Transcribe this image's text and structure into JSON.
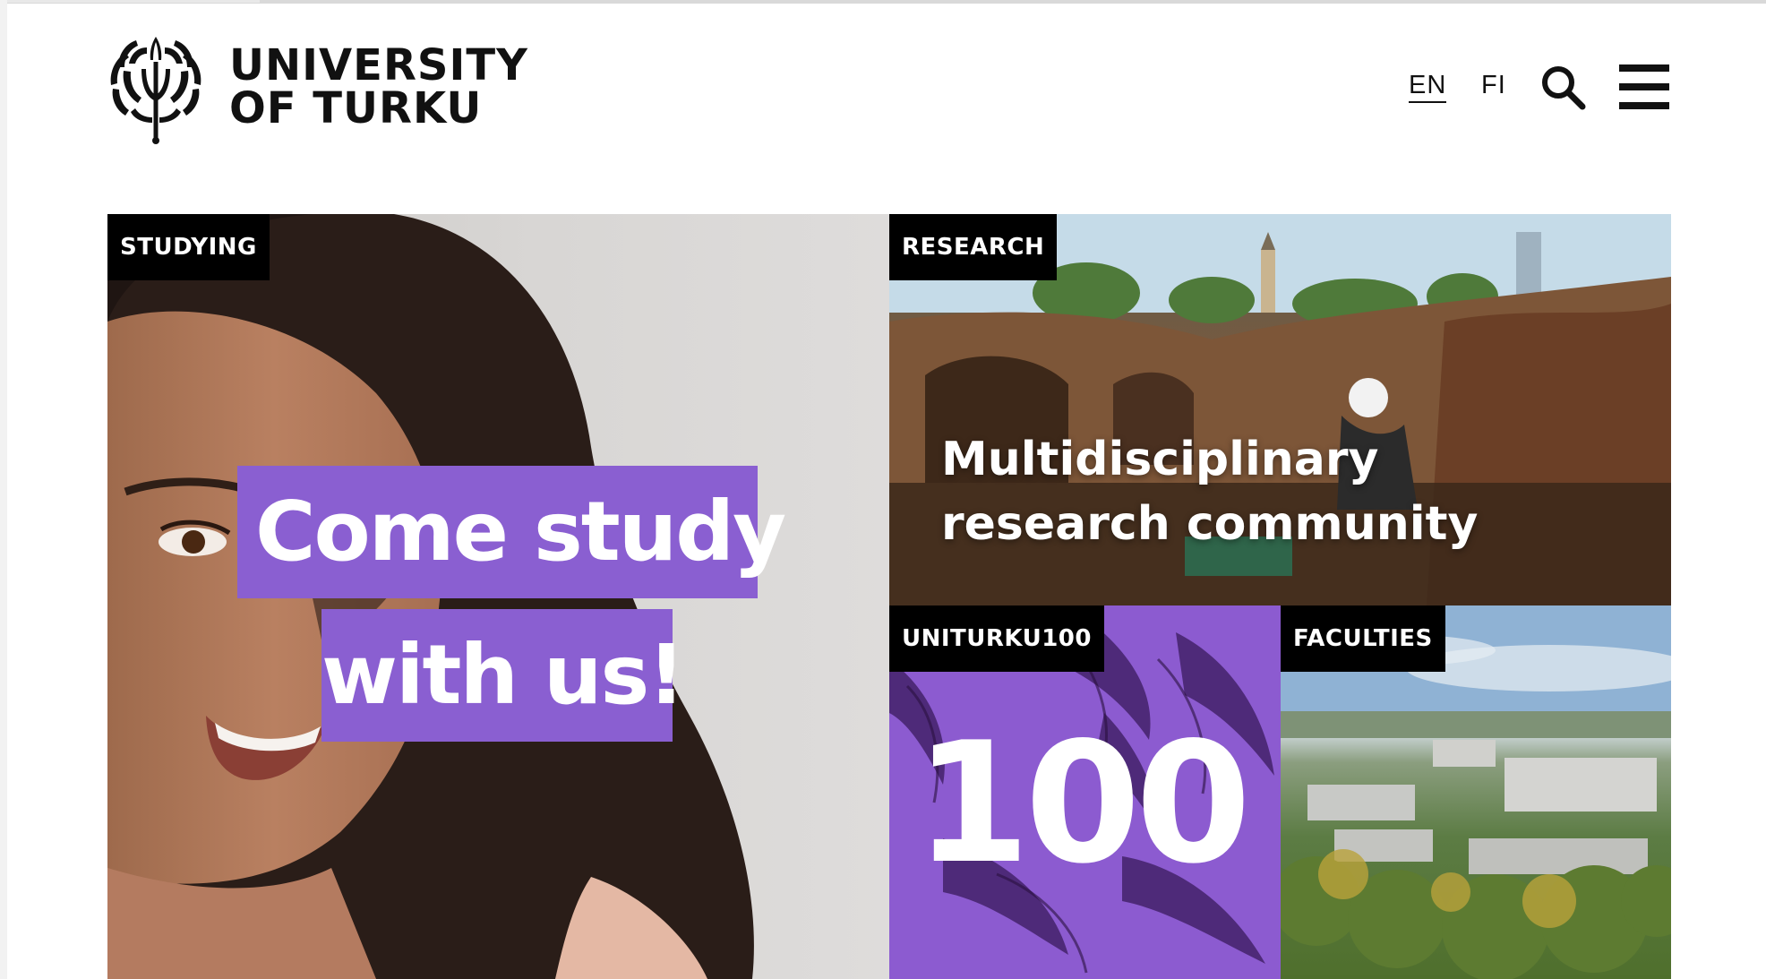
{
  "header": {
    "logo_line1": "UNIVERSITY",
    "logo_line2": "OF TURKU",
    "lang_en": "EN",
    "lang_fi": "FI"
  },
  "tiles": {
    "studying": {
      "tag": "STUDYING",
      "headline_line1": "Come study",
      "headline_line2": "with us!"
    },
    "research": {
      "tag": "RESEARCH",
      "title": "Multidisciplinary research community"
    },
    "unituku100": {
      "tag": "UNITURKU100",
      "number": "100"
    },
    "faculties": {
      "tag": "FACULTIES"
    }
  },
  "colors": {
    "accent_purple": "#8a5fd1",
    "tag_background": "#000000",
    "text": "#111111"
  },
  "icons": [
    "university-logo-icon",
    "search-icon",
    "menu-icon"
  ]
}
